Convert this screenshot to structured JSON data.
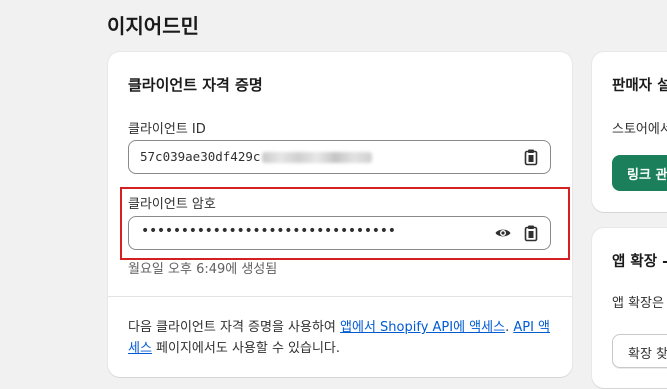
{
  "page": {
    "title": "이지어드민"
  },
  "credentials": {
    "title": "클라이언트 자격 증명",
    "client_id_label": "클라이언트 ID",
    "client_id_value": "57c039ae30df429c",
    "client_secret_label": "클라이언트 암호",
    "client_secret_masked": "••••••••••••••••••••••••••••••••",
    "created_text": "월요일 오후 6:49에 생성됨",
    "footer_prefix": "다음 클라이언트 자격 증명을 사용하여 ",
    "footer_link1": "앱에서 Shopify API에 액세스",
    "footer_mid": ". ",
    "footer_link2": "API 액세스",
    "footer_suffix": " 페이지에서도 사용할 수 있습니다."
  },
  "sidebar_card_1": {
    "title": "판매자 설",
    "text": "스토어에서",
    "button_label": "링크 관"
  },
  "sidebar_card_2": {
    "title": "앱 확장 -",
    "text": "앱 확장은",
    "button_label": "확장 찾"
  },
  "colors": {
    "highlight_border": "#d32020",
    "primary_button": "#1a7f5a",
    "link": "#005bd3",
    "background": "#f1f1f1"
  },
  "icons": [
    "clipboard-icon",
    "eye-icon"
  ]
}
